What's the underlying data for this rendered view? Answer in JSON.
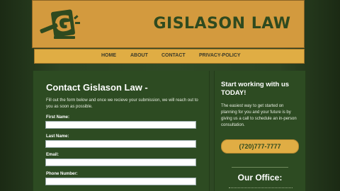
{
  "header": {
    "site_title": "GISLASON LAW",
    "logo_letter": "G"
  },
  "nav": {
    "items": [
      {
        "label": "HOME"
      },
      {
        "label": "ABOUT"
      },
      {
        "label": "CONTACT"
      },
      {
        "label": "PRIVACY-POLICY"
      }
    ]
  },
  "main": {
    "title": "Contact Gislason Law -",
    "intro": "Fill out the form below and once we recieve your submission, we will reach out to you as soon as possible.",
    "fields": [
      {
        "label": "First Name:",
        "value": ""
      },
      {
        "label": "Last Name:",
        "value": ""
      },
      {
        "label": "Email:",
        "value": ""
      },
      {
        "label": "Phone Number:",
        "value": ""
      }
    ]
  },
  "sidebar": {
    "heading": "Start working with us TODAY!",
    "description": "The easiest way to get started on planning for you and your future is by giving us a call to schedule an in-person consultation.",
    "phone": "(720)777-7777",
    "office_title": "Our Office:"
  },
  "colors": {
    "header_bg": "#d39a3e",
    "nav_bg": "#e0ad44",
    "panel_bg": "#2d4b22",
    "title_text": "#2f4a1f"
  }
}
